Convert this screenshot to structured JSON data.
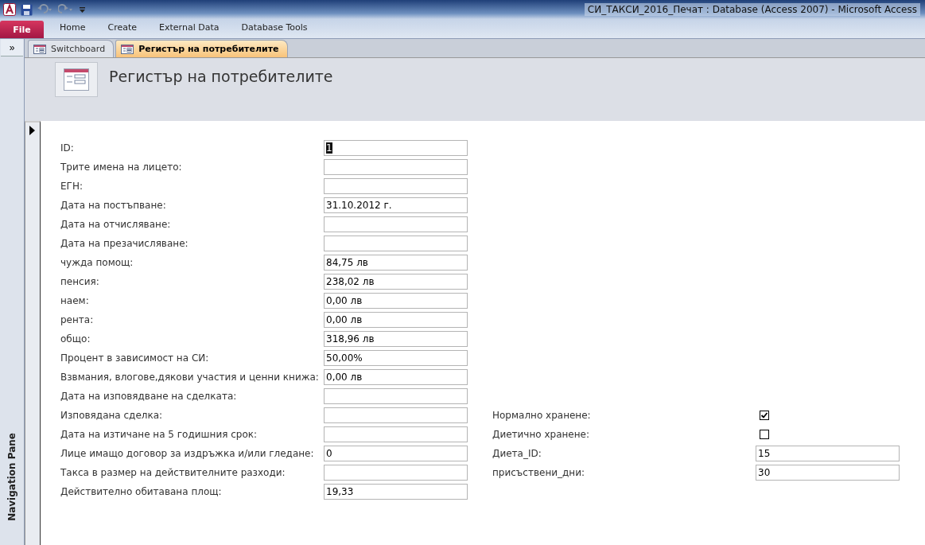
{
  "window": {
    "title": "СИ_ТАКСИ_2016_Печат : Database (Access 2007)  -  Microsoft Access"
  },
  "ribbon_tabs": [
    {
      "label": "File",
      "kind": "file",
      "selected": false
    },
    {
      "label": "Home",
      "kind": "tab",
      "selected": false
    },
    {
      "label": "Create",
      "kind": "tab",
      "selected": false
    },
    {
      "label": "External Data",
      "kind": "tab",
      "selected": false
    },
    {
      "label": "Database Tools",
      "kind": "tab",
      "selected": false
    }
  ],
  "navigation_pane": {
    "toggle": "»",
    "label": "Navigation Pane"
  },
  "document_tabs": [
    {
      "label": "Switchboard",
      "selected": false
    },
    {
      "label": "Регистър на потребителите",
      "selected": true
    }
  ],
  "form": {
    "title": "Регистър на потребителите",
    "fields": [
      {
        "label": "ID:",
        "value": "1",
        "focused": true
      },
      {
        "label": "Трите имена на лицето:"
      },
      {
        "label": "ЕГН:"
      },
      {
        "label": "Дата на постъпване:",
        "value": "31.10.2012 г."
      },
      {
        "label": "Дата на отчисляване:"
      },
      {
        "label": "Дата на презачисляване:"
      },
      {
        "label": "чужда помощ:",
        "value": "84,75 лв"
      },
      {
        "label": "пенсия:",
        "value": "238,02 лв"
      },
      {
        "label": "наем:",
        "value": "0,00 лв"
      },
      {
        "label": "рента:",
        "value": "0,00 лв"
      },
      {
        "label": "общо:",
        "value": "318,96 лв"
      },
      {
        "label": "Процент в зависимост на СИ:",
        "value": "50,00%"
      },
      {
        "label": "Взвмания, влогове,дякови участия и ценни книжа:",
        "value": "0,00 лв"
      },
      {
        "label": "Дата на изповядване на сделката:"
      },
      {
        "label": "Изповядана сделка:"
      },
      {
        "label": "Дата на изтичане на 5 годишния срок:"
      },
      {
        "label": "Лице имащо договор за издръжка и/или гледане:",
        "value": "0"
      },
      {
        "label": "Такса в размер на действителните разходи:"
      },
      {
        "label": "Действително обитавана площ:",
        "value": "19,33"
      }
    ],
    "side_fields": [
      {
        "label": "Нормално хранене:",
        "kind": "checkbox",
        "checked": true
      },
      {
        "label": "Диетично хранене:",
        "kind": "checkbox",
        "checked": false
      },
      {
        "label": "Диета_ID:",
        "kind": "text",
        "value": "15"
      },
      {
        "label": "присъствени_дни:",
        "kind": "text",
        "value": "30"
      }
    ]
  }
}
